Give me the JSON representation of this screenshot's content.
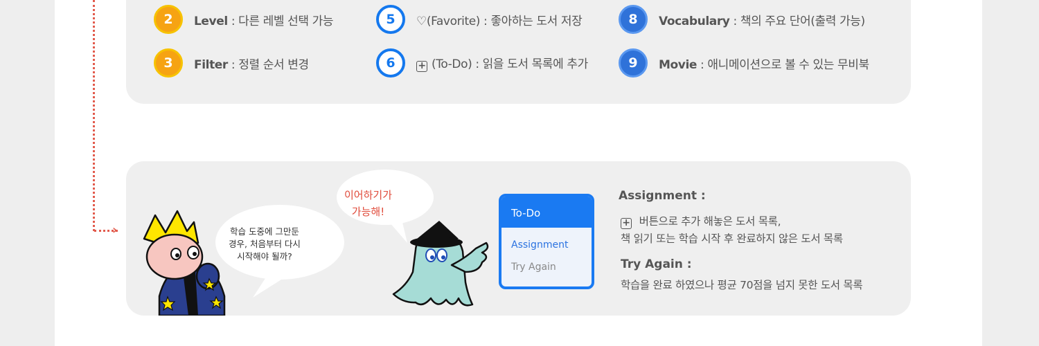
{
  "legend": {
    "items": [
      {
        "num": "2",
        "title": "Level",
        "desc": " : 다른 레벨 선택 가능",
        "style": "orange"
      },
      {
        "num": "3",
        "title": "Filter",
        "desc": " : 정렬 순서 변경",
        "style": "orange"
      },
      {
        "num": "5",
        "title": "♡(Favorite)",
        "desc": " : 좋아하는 도서 저장",
        "style": "ring"
      },
      {
        "num": "6",
        "title": "(To-Do)",
        "desc": " : 읽을 도서 목록에 추가",
        "style": "ring"
      },
      {
        "num": "8",
        "title": "Vocabulary",
        "desc": " : 책의 주요 단어(출력 가능)",
        "style": "blue"
      },
      {
        "num": "9",
        "title": "Movie",
        "desc": " : 애니메이션으로 볼 수 있는 무비북",
        "style": "blue"
      }
    ]
  },
  "bubbles": {
    "student": [
      "학습 도중에 그만둔",
      "경우, 처음부터 다시",
      "시작해야 될까?"
    ],
    "ghost": [
      "이어하기가",
      "가능해!"
    ]
  },
  "todo_card": {
    "header": "To-Do",
    "items": [
      "Assignment",
      "Try Again"
    ]
  },
  "descriptions": {
    "assignment_title": "Assignment :",
    "assignment_line1": "버튼으로 추가 해놓은 도서 목록,",
    "assignment_line2": "책 읽기 또는 학습 시작 후 완료하지 않은 도서 목록",
    "tryagain_title": "Try Again :",
    "tryagain_line": "학습을 완료 하였으나 평균 70점을 넘지 못한 도서 목록"
  },
  "colors": {
    "orange_badge": "#f6a313",
    "blue_ring": "#1478ee",
    "blue_badge": "#2f72d9",
    "dotted_line": "#e25b4d",
    "card_blue": "#1a7af2"
  },
  "icons": {
    "plus": "plus-square-icon",
    "arrow": "double-chevron-right-icon"
  }
}
